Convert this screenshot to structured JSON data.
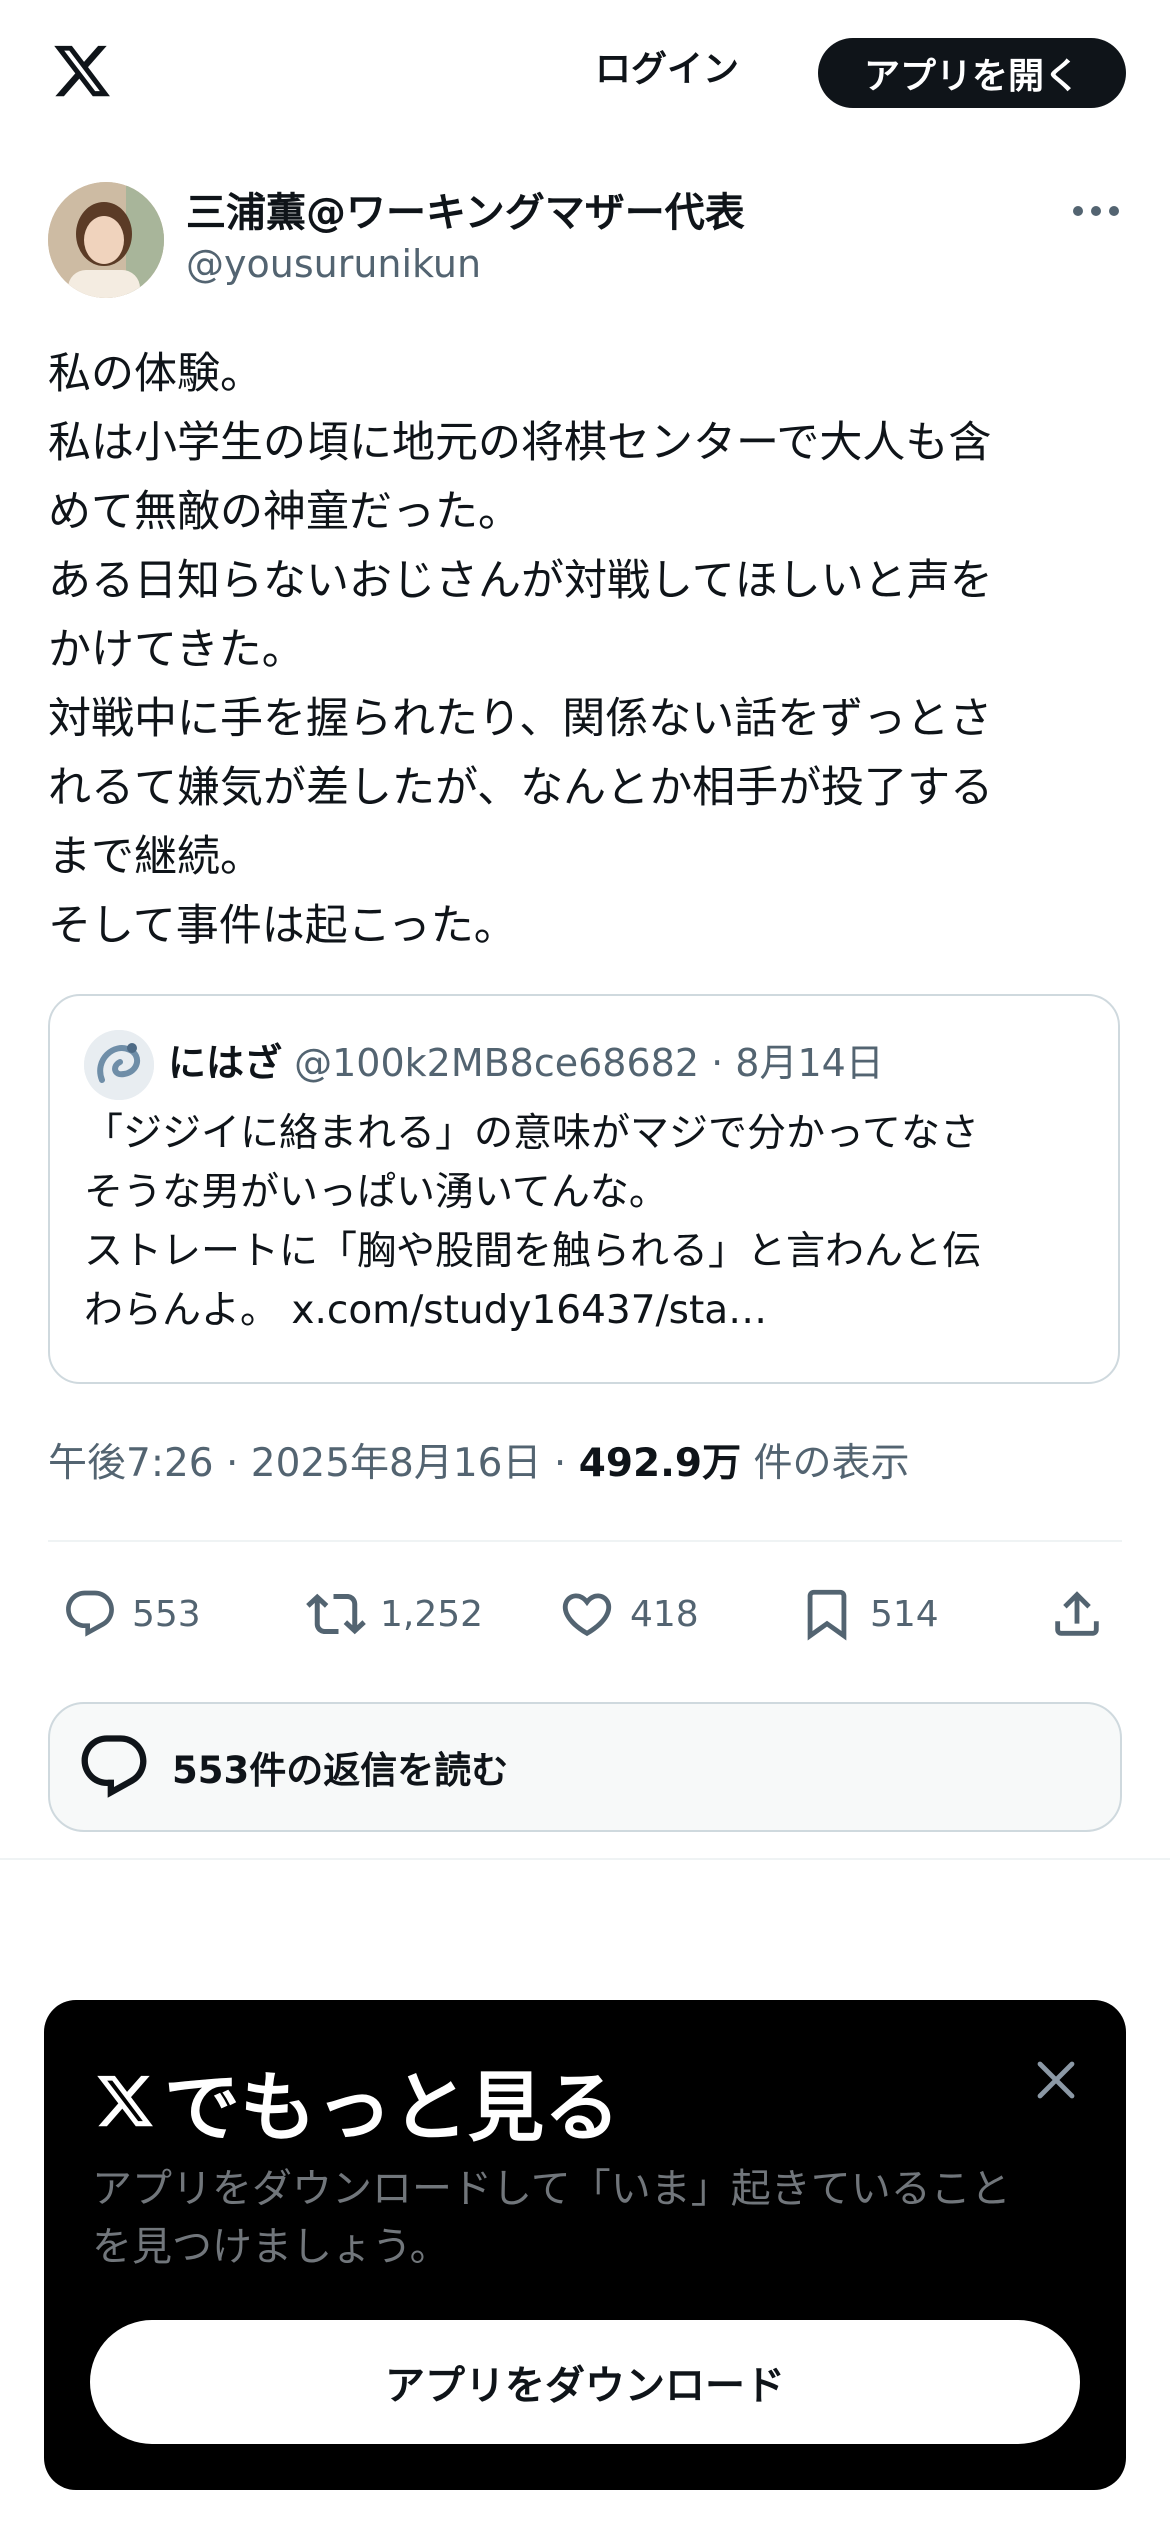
{
  "header": {
    "login_label": "ログイン",
    "open_app_label": "アプリを開く"
  },
  "tweet": {
    "author_name": "三浦薫@ワーキングマザー代表",
    "author_handle": "@yousurunikun",
    "text_lines": [
      "私の体験。",
      "私は小学生の頃に地元の将棋センターで大人も含",
      "めて無敵の神童だった。",
      "ある日知らないおじさんが対戦してほしいと声を",
      "かけてきた。",
      "対戦中に手を握られたり、関係ない話をずっとさ",
      "れるて嫌気が差したが、なんとか相手が投了する",
      "まで継続。",
      "そして事件は起こった。"
    ],
    "time": "午後7:26",
    "date": "2025年8月16日",
    "views_count": "492.9万",
    "views_label": "件の表示"
  },
  "quote": {
    "name": "にはざ",
    "handle": "@100k2MB8ce68682",
    "date": "8月14日",
    "lines": [
      "「ジジイに絡まれる」の意味がマジで分かってなさ",
      "そうな男がいっぱい湧いてんな。",
      "ストレートに「胸や股間を触られる」と言わんと伝",
      "わらんよ。 x.com/study16437/sta…"
    ]
  },
  "actions": {
    "replies": "553",
    "reposts": "1,252",
    "likes": "418",
    "bookmarks": "514"
  },
  "read_replies_label": "553件の返信を読む",
  "promo": {
    "title": "でもっと見る",
    "subtitle_lines": [
      "アプリをダウンロードして「いま」起きていること",
      "を見つけましょう。"
    ],
    "download_label": "アプリをダウンロード"
  },
  "colors": {
    "text": "#0f1419",
    "secondary": "#536471",
    "border": "#cfd9de",
    "promo_bg": "#000000"
  }
}
